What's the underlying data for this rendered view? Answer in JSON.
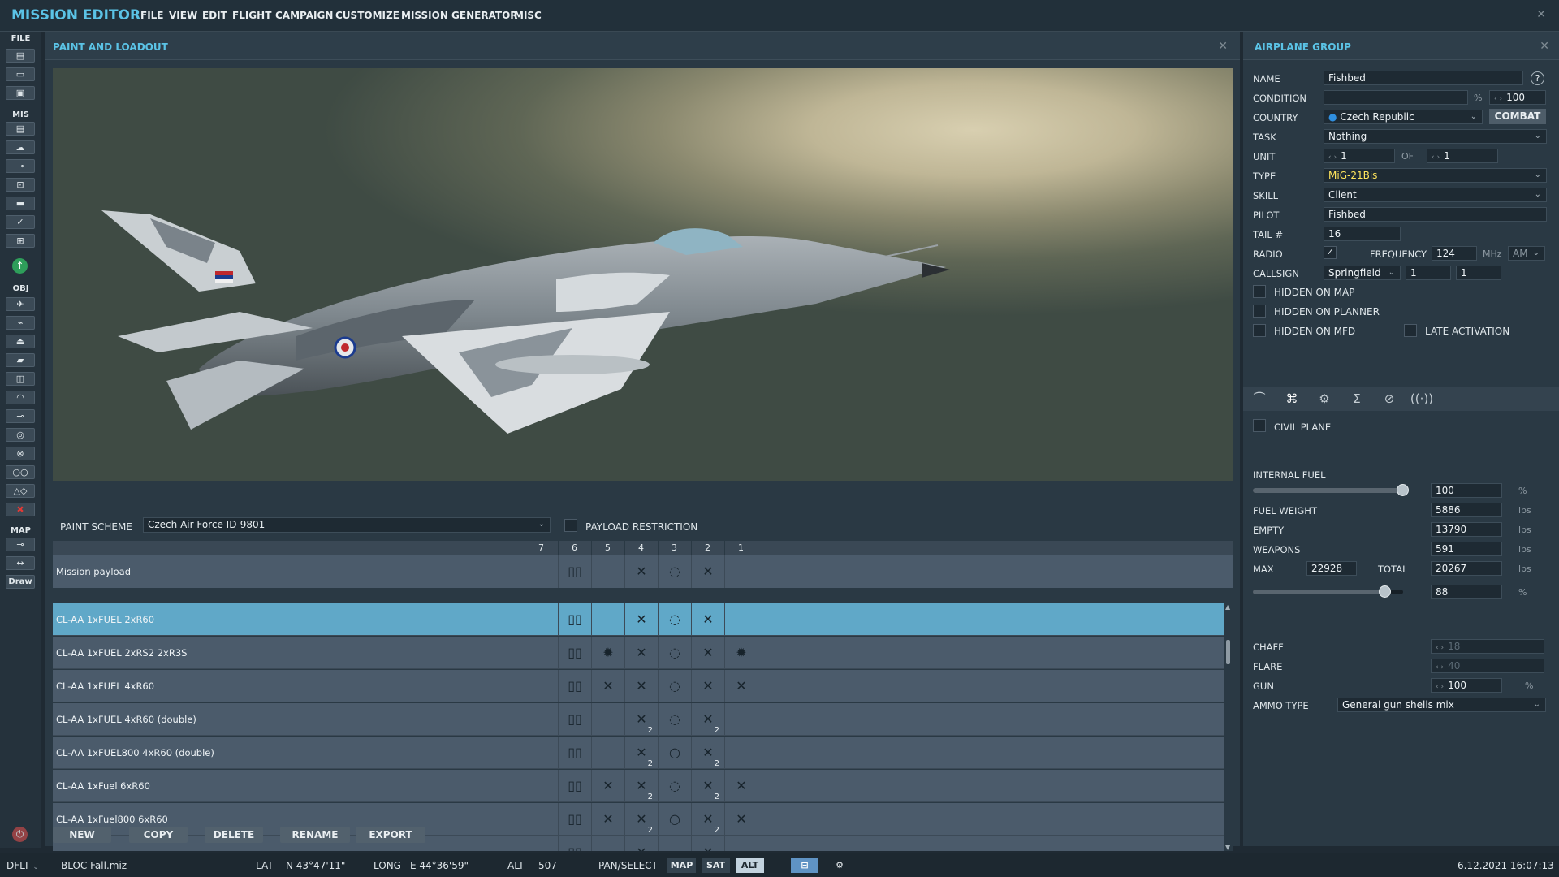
{
  "app": {
    "title": "MISSION EDITOR",
    "menu": [
      "FILE",
      "VIEW",
      "EDIT",
      "FLIGHT",
      "CAMPAIGN",
      "CUSTOMIZE",
      "MISSION GENERATOR",
      "MISC"
    ],
    "close_icon": "close-icon"
  },
  "toolbar": {
    "sections": {
      "file": "FILE",
      "mis": "MIS",
      "obj": "OBJ",
      "map": "MAP"
    },
    "draw_label": "Draw",
    "file_icons": [
      "new-file-icon",
      "open-folder-icon",
      "save-icon"
    ],
    "mis_icons": [
      "clipboard-icon",
      "weather-icon",
      "trigger-icon",
      "goals-icon",
      "actions-icon",
      "check-icon",
      "groups-icon",
      "accept-icon"
    ],
    "obj_icons": [
      "airplane-icon",
      "helicopter-icon",
      "ship-icon",
      "ground-unit-icon",
      "static-object-icon",
      "zone-icon",
      "waypoint-icon",
      "target-icon",
      "bullseye-icon",
      "template-icon",
      "shapes-icon",
      "delete-icon"
    ],
    "map_icons": [
      "key-icon",
      "ruler-icon"
    ]
  },
  "paint_panel": {
    "title": "PAINT AND LOADOUT",
    "paint_scheme_label": "PAINT SCHEME",
    "paint_scheme_value": "Czech Air Force ID-9801",
    "payload_restriction_label": "PAYLOAD RESTRICTION",
    "payload_restriction_checked": false,
    "stations": [
      "7",
      "6",
      "5",
      "4",
      "3",
      "2",
      "1"
    ],
    "mission_payload": {
      "name": "Mission payload",
      "cells": [
        {
          "glyph": "",
          "sub": ""
        },
        {
          "glyph": "▯▯",
          "sub": ""
        },
        {
          "glyph": "",
          "sub": ""
        },
        {
          "glyph": "✕",
          "sub": ""
        },
        {
          "glyph": "◌",
          "sub": ""
        },
        {
          "glyph": "✕",
          "sub": ""
        },
        {
          "glyph": "",
          "sub": ""
        }
      ]
    },
    "loadouts": [
      {
        "name": "CL-AA 1xFUEL 2xR60",
        "selected": true,
        "cells": [
          {
            "glyph": "",
            "sub": ""
          },
          {
            "glyph": "▯▯",
            "sub": ""
          },
          {
            "glyph": "",
            "sub": ""
          },
          {
            "glyph": "✕",
            "sub": ""
          },
          {
            "glyph": "◌",
            "sub": ""
          },
          {
            "glyph": "✕",
            "sub": ""
          },
          {
            "glyph": "",
            "sub": ""
          }
        ]
      },
      {
        "name": "CL-AA 1xFUEL 2xRS2 2xR3S",
        "selected": false,
        "cells": [
          {
            "glyph": "",
            "sub": ""
          },
          {
            "glyph": "▯▯",
            "sub": ""
          },
          {
            "glyph": "✹",
            "sub": ""
          },
          {
            "glyph": "✕",
            "sub": ""
          },
          {
            "glyph": "◌",
            "sub": ""
          },
          {
            "glyph": "✕",
            "sub": ""
          },
          {
            "glyph": "✹",
            "sub": ""
          }
        ]
      },
      {
        "name": "CL-AA 1xFUEL 4xR60",
        "selected": false,
        "cells": [
          {
            "glyph": "",
            "sub": ""
          },
          {
            "glyph": "▯▯",
            "sub": ""
          },
          {
            "glyph": "✕",
            "sub": ""
          },
          {
            "glyph": "✕",
            "sub": ""
          },
          {
            "glyph": "◌",
            "sub": ""
          },
          {
            "glyph": "✕",
            "sub": ""
          },
          {
            "glyph": "✕",
            "sub": ""
          }
        ]
      },
      {
        "name": "CL-AA 1xFUEL 4xR60 (double)",
        "selected": false,
        "cells": [
          {
            "glyph": "",
            "sub": ""
          },
          {
            "glyph": "▯▯",
            "sub": ""
          },
          {
            "glyph": "",
            "sub": ""
          },
          {
            "glyph": "✕",
            "sub": "2"
          },
          {
            "glyph": "◌",
            "sub": ""
          },
          {
            "glyph": "✕",
            "sub": "2"
          },
          {
            "glyph": "",
            "sub": ""
          }
        ]
      },
      {
        "name": "CL-AA 1xFUEL800 4xR60 (double)",
        "selected": false,
        "cells": [
          {
            "glyph": "",
            "sub": ""
          },
          {
            "glyph": "▯▯",
            "sub": ""
          },
          {
            "glyph": "",
            "sub": ""
          },
          {
            "glyph": "✕",
            "sub": "2"
          },
          {
            "glyph": "○",
            "sub": ""
          },
          {
            "glyph": "✕",
            "sub": "2"
          },
          {
            "glyph": "",
            "sub": ""
          }
        ]
      },
      {
        "name": "CL-AA 1xFuel 6xR60",
        "selected": false,
        "cells": [
          {
            "glyph": "",
            "sub": ""
          },
          {
            "glyph": "▯▯",
            "sub": ""
          },
          {
            "glyph": "✕",
            "sub": ""
          },
          {
            "glyph": "✕",
            "sub": "2"
          },
          {
            "glyph": "◌",
            "sub": ""
          },
          {
            "glyph": "✕",
            "sub": "2"
          },
          {
            "glyph": "✕",
            "sub": ""
          }
        ]
      },
      {
        "name": "CL-AA 1xFuel800 6xR60",
        "selected": false,
        "cells": [
          {
            "glyph": "",
            "sub": ""
          },
          {
            "glyph": "▯▯",
            "sub": ""
          },
          {
            "glyph": "✕",
            "sub": ""
          },
          {
            "glyph": "✕",
            "sub": "2"
          },
          {
            "glyph": "○",
            "sub": ""
          },
          {
            "glyph": "✕",
            "sub": "2"
          },
          {
            "glyph": "✕",
            "sub": ""
          }
        ]
      },
      {
        "name": "",
        "selected": false,
        "cells": [
          {
            "glyph": "",
            "sub": ""
          },
          {
            "glyph": "▯▯",
            "sub": ""
          },
          {
            "glyph": "",
            "sub": ""
          },
          {
            "glyph": "✕",
            "sub": ""
          },
          {
            "glyph": "",
            "sub": ""
          },
          {
            "glyph": "✕",
            "sub": ""
          },
          {
            "glyph": "",
            "sub": ""
          }
        ]
      }
    ],
    "buttons": {
      "new": "NEW",
      "copy": "COPY",
      "delete": "DELETE",
      "rename": "RENAME",
      "export": "EXPORT"
    }
  },
  "airplane_group": {
    "title": "AIRPLANE GROUP",
    "name_label": "NAME",
    "name_value": "Fishbed",
    "help": "?",
    "condition_label": "CONDITION",
    "condition_value": "",
    "condition_unit": "%",
    "condition_pct": "100",
    "country_label": "COUNTRY",
    "country_value": "Czech Republic",
    "combat_label": "COMBAT",
    "task_label": "TASK",
    "task_value": "Nothing",
    "unit_label": "UNIT",
    "unit_value": "1",
    "of_label": "OF",
    "of_value": "1",
    "type_label": "TYPE",
    "type_value": "MiG-21Bis",
    "skill_label": "SKILL",
    "skill_value": "Client",
    "pilot_label": "PILOT",
    "pilot_value": "Fishbed",
    "tail_label": "TAIL #",
    "tail_value": "16",
    "radio_label": "RADIO",
    "radio_checked": true,
    "frequency_label": "FREQUENCY",
    "frequency_value": "124",
    "frequency_unit": "MHz",
    "modulation": "AM",
    "callsign_label": "CALLSIGN",
    "callsign_value": "Springfield",
    "callsign_n1": "1",
    "callsign_n2": "1",
    "hidden_on_map": "HIDDEN ON MAP",
    "hidden_on_planner": "HIDDEN ON PLANNER",
    "hidden_on_mfd": "HIDDEN ON MFD",
    "late_activation": "LATE ACTIVATION",
    "tabs": [
      "route-icon",
      "payload-icon",
      "properties-icon",
      "summary-icon",
      "failures-icon",
      "radio-icon"
    ],
    "civil_plane": "CIVIL PLANE",
    "internal_fuel_label": "INTERNAL FUEL",
    "internal_fuel_value": "100",
    "internal_fuel_fraction": 1.0,
    "pct": "%",
    "fuel_weight_label": "FUEL WEIGHT",
    "fuel_weight_value": "5886",
    "empty_label": "EMPTY",
    "empty_value": "13790",
    "weapons_label": "WEAPONS",
    "weapons_value": "591",
    "max_label": "MAX",
    "max_value": "22928",
    "total_label": "TOTAL",
    "total_value": "20267",
    "lbs": "lbs",
    "total_pct_value": "88",
    "total_fraction": 0.88,
    "chaff_label": "CHAFF",
    "chaff_value": "18",
    "flare_label": "FLARE",
    "flare_value": "40",
    "gun_label": "GUN",
    "gun_value": "100",
    "ammo_label": "AMMO TYPE",
    "ammo_value": "General gun shells mix"
  },
  "status": {
    "profile": "DFLT",
    "file": "BLOC Fall.miz",
    "lat_label": "LAT",
    "lat_value": "N 43°47'11\"",
    "long_label": "LONG",
    "long_value": "E 44°36'59\"",
    "alt_label": "ALT",
    "alt_value": "507",
    "pan_select": "PAN/SELECT",
    "map": "MAP",
    "sat": "SAT",
    "alt_btn": "ALT",
    "datetime": "6.12.2021 16:07:13"
  }
}
